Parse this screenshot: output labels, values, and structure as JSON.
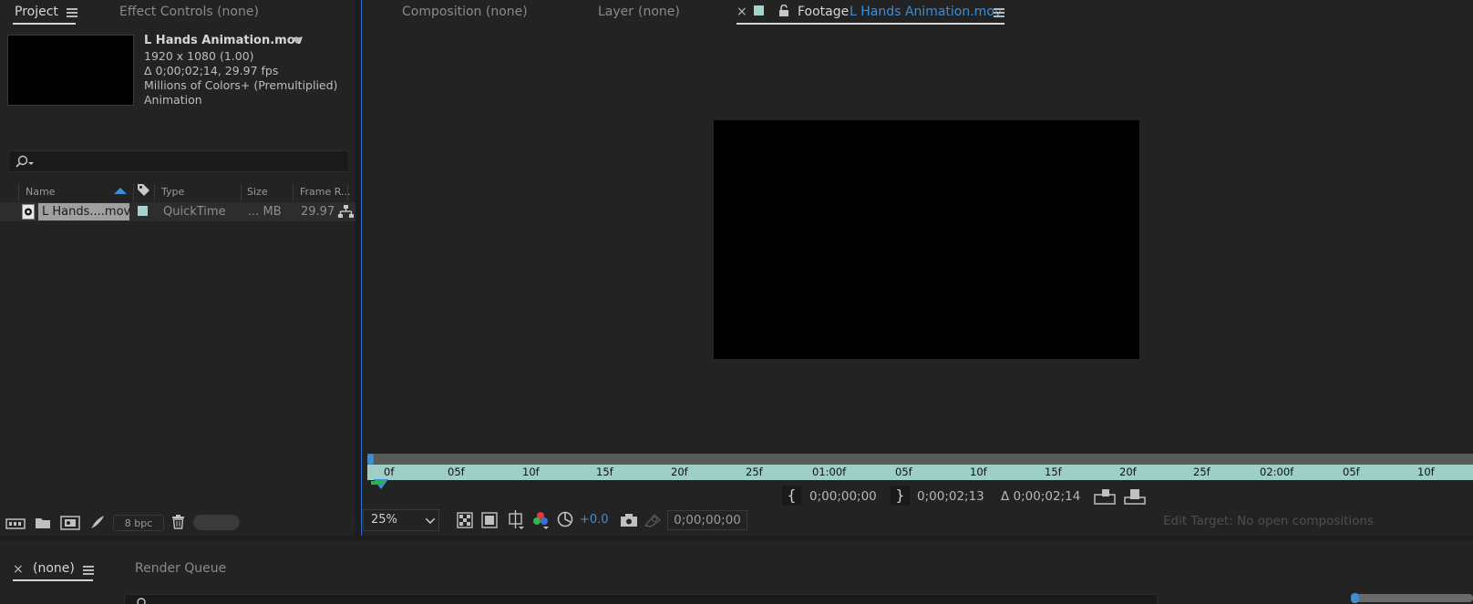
{
  "project_panel": {
    "tabs": [
      "Project",
      "Effect Controls (none)"
    ],
    "footage": {
      "name": "L Hands Animation.mov",
      "resolution": "1920 x 1080 (1.00)",
      "duration": "Δ 0;00;02;14, 29.97 fps",
      "color_depth": "Millions of Colors+ (Premultiplied)",
      "codec": "Animation"
    },
    "columns": [
      "Name",
      "Type",
      "Size",
      "Frame R..."
    ],
    "items": [
      {
        "name": "L Hands....mov",
        "type": "QuickTime",
        "size": "... MB",
        "frame_rate": "29.97",
        "label_color": "#a6d4cc"
      }
    ],
    "footer": {
      "bpc": "8 bpc"
    }
  },
  "viewer_panel": {
    "tabs": {
      "composition": "Composition (none)",
      "layer_label": "Layer",
      "layer_value": "(none)",
      "footage_label": "Footage",
      "footage_value": "L Hands Animation.mov"
    },
    "ruler_ticks": [
      "0f",
      "05f",
      "10f",
      "15f",
      "20f",
      "25f",
      "01:00f",
      "05f",
      "10f",
      "15f",
      "20f",
      "25f",
      "02:00f",
      "05f",
      "10f"
    ],
    "in_point": "0;00;00;00",
    "out_point": "0;00;02;13",
    "duration": "Δ 0;00;02;14",
    "zoom": "25%",
    "exposure": "+0.0",
    "current_time": "0;00;00;00",
    "edit_target": "Edit Target: No open compositions"
  },
  "timeline_panel": {
    "tabs": [
      "(none)",
      "Render Queue"
    ]
  },
  "colors": {
    "accent": "#3b8ed8",
    "ruler": "#9ecfc6",
    "label_aqua": "#a6d4cc"
  }
}
